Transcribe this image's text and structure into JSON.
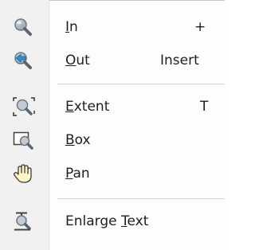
{
  "menu": {
    "items": [
      {
        "accel": "I",
        "rest": "n",
        "shortcut": "+",
        "icon": "zoom-in-icon"
      },
      {
        "accel": "O",
        "rest": "ut",
        "shortcut": "Insert",
        "icon": "zoom-out-icon"
      },
      {
        "accel": "E",
        "rest": "xtent",
        "shortcut": "T",
        "icon": "zoom-extent-icon"
      },
      {
        "accel": "B",
        "rest": "ox",
        "shortcut": "",
        "icon": "zoom-box-icon"
      },
      {
        "accel": "P",
        "rest": "an",
        "shortcut": "",
        "icon": "pan-hand-icon"
      },
      {
        "pre": "Enlarge ",
        "accel": "T",
        "rest": "ext",
        "shortcut": "",
        "icon": "enlarge-text-icon"
      }
    ]
  }
}
